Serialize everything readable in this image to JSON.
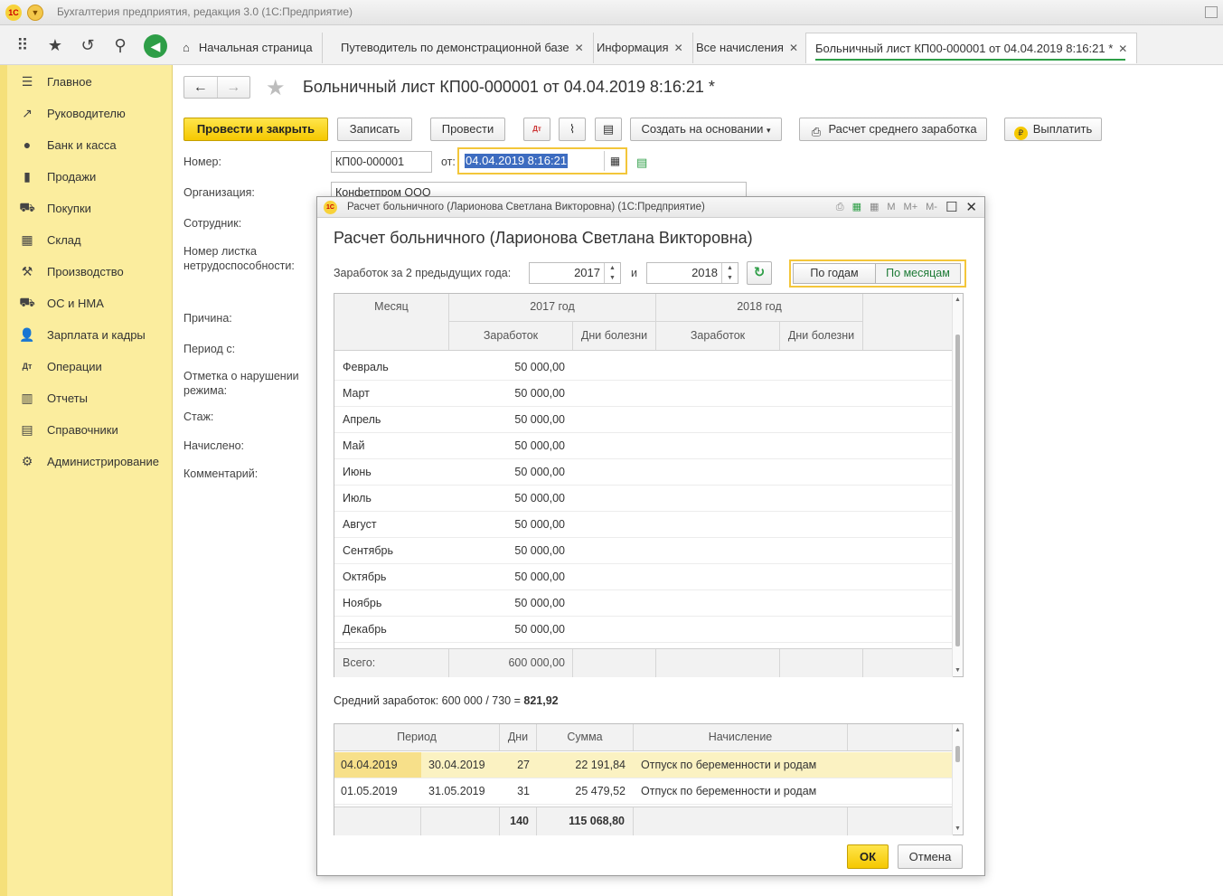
{
  "window": {
    "title": "Бухгалтерия предприятия, редакция 3.0  (1С:Предприятие)",
    "logo": "1С"
  },
  "tabs": [
    {
      "label": "Начальная страница",
      "home_icon": "⌂"
    },
    {
      "label": "Путеводитель по демонстрационной базе",
      "close": "✕"
    },
    {
      "label": "Информация",
      "close": "✕"
    },
    {
      "label": "Все начисления",
      "close": "✕"
    },
    {
      "label": "Больничный лист КП00-000001 от 04.04.2019 8:16:21 *",
      "close": "✕"
    }
  ],
  "sidebar": {
    "items": [
      {
        "label": "Главное",
        "icon": "☰"
      },
      {
        "label": "Руководителю",
        "icon": "↗"
      },
      {
        "label": "Банк и касса",
        "icon": "●"
      },
      {
        "label": "Продажи",
        "icon": "▮"
      },
      {
        "label": "Покупки",
        "icon": "⛟"
      },
      {
        "label": "Склад",
        "icon": "▦"
      },
      {
        "label": "Производство",
        "icon": "⚒"
      },
      {
        "label": "ОС и НМА",
        "icon": "⛟"
      },
      {
        "label": "Зарплата и кадры",
        "icon": "👤"
      },
      {
        "label": "Операции",
        "icon": "Дт"
      },
      {
        "label": "Отчеты",
        "icon": "▥"
      },
      {
        "label": "Справочники",
        "icon": "▤"
      },
      {
        "label": "Администрирование",
        "icon": "⚙"
      }
    ]
  },
  "doc": {
    "title": "Больничный лист КП00-000001 от 04.04.2019 8:16:21 *",
    "buttons": {
      "post_close": "Провести и закрыть",
      "save": "Записать",
      "post": "Провести",
      "create_based": "Создать на основании",
      "avg_calc": "Расчет среднего заработка",
      "pay": "Выплатить"
    },
    "labels": {
      "number": "Номер:",
      "from": "от:",
      "org": "Организация:",
      "employee": "Сотрудник:",
      "sheet_no": "Номер листка нетрудоспособности:",
      "reason": "Причина:",
      "period": "Период с:",
      "violation": "Отметка о нарушении режима:",
      "stazh": "Стаж:",
      "accrued": "Начислено:",
      "comment": "Комментарий:"
    },
    "number_value": "КП00-000001",
    "date_value": "04.04.2019  8:16:21",
    "org_value": "Конфетпром ООО"
  },
  "modal": {
    "title": "Расчет больничного (Ларионова Светлана Викторовна)  (1С:Предприятие)",
    "heading": "Расчет больничного (Ларионова Светлана Викторовна)",
    "tools": [
      "M",
      "M+",
      "M-"
    ],
    "earnings_label": "Заработок за 2 предыдущих года:",
    "and_label": "и",
    "year1": "2017",
    "year2": "2018",
    "toggle": {
      "by_years": "По годам",
      "by_months": "По месяцам"
    },
    "table": {
      "col_month": "Месяц",
      "col_2017": "2017 год",
      "col_2018": "2018 год",
      "col_earn": "Заработок",
      "col_sick": "Дни болезни",
      "rows": [
        {
          "month": "Февраль",
          "earn": "50 000,00"
        },
        {
          "month": "Март",
          "earn": "50 000,00"
        },
        {
          "month": "Апрель",
          "earn": "50 000,00"
        },
        {
          "month": "Май",
          "earn": "50 000,00"
        },
        {
          "month": "Июнь",
          "earn": "50 000,00"
        },
        {
          "month": "Июль",
          "earn": "50 000,00"
        },
        {
          "month": "Август",
          "earn": "50 000,00"
        },
        {
          "month": "Сентябрь",
          "earn": "50 000,00"
        },
        {
          "month": "Октябрь",
          "earn": "50 000,00"
        },
        {
          "month": "Ноябрь",
          "earn": "50 000,00"
        },
        {
          "month": "Декабрь",
          "earn": "50 000,00"
        }
      ],
      "total_label": "Всего:",
      "total_value": "600 000,00"
    },
    "avg_prefix": "Средний заработок: 600 000 / 730 = ",
    "avg_value": "821,92",
    "periods": {
      "col_period": "Период",
      "col_days": "Дни",
      "col_sum": "Сумма",
      "col_accrual": "Начисление",
      "rows": [
        {
          "from": "04.04.2019",
          "to": "30.04.2019",
          "days": "27",
          "sum": "22 191,84",
          "accrual": "Отпуск по беременности и родам"
        },
        {
          "from": "01.05.2019",
          "to": "31.05.2019",
          "days": "31",
          "sum": "25 479,52",
          "accrual": "Отпуск по беременности и родам"
        }
      ],
      "total_days": "140",
      "total_sum": "115 068,80"
    },
    "ok": "ОК",
    "cancel": "Отмена"
  }
}
